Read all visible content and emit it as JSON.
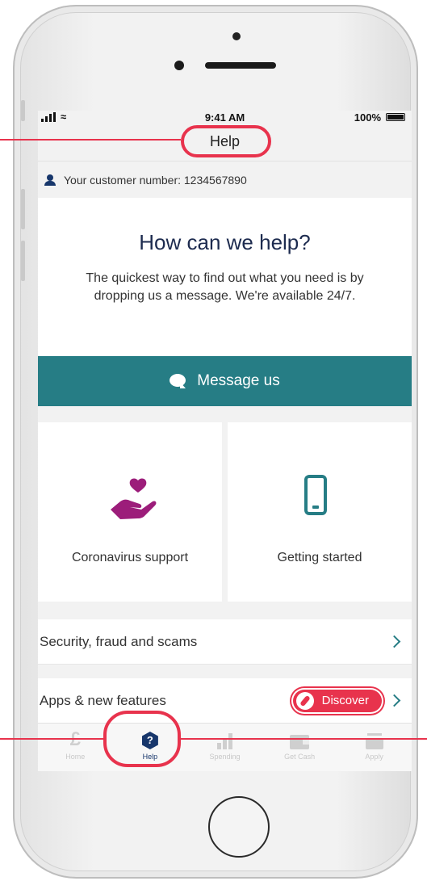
{
  "status_bar": {
    "time": "9:41 AM",
    "battery": "100%"
  },
  "header": {
    "title": "Help"
  },
  "customer": {
    "text": "Your customer number: 1234567890"
  },
  "help": {
    "heading": "How can we help?",
    "body": "The quickest way to find out what you need is by dropping us a message. We're available 24/7.",
    "message_button": "Message us"
  },
  "tiles": [
    {
      "label": "Coronavirus support",
      "icon": "heart-hand-icon",
      "color": "#9c1d7a"
    },
    {
      "label": "Getting started",
      "icon": "phone-icon",
      "color": "#267d85"
    }
  ],
  "list": [
    {
      "label": "Security, fraud and scams"
    },
    {
      "label": "Apps & new features",
      "badge": "Discover"
    }
  ],
  "tab_bar": [
    {
      "label": "Home",
      "icon": "pound-icon",
      "active": false
    },
    {
      "label": "Help",
      "icon": "help-icon",
      "active": true
    },
    {
      "label": "Spending",
      "icon": "bar-chart-icon",
      "active": false
    },
    {
      "label": "Get Cash",
      "icon": "wallet-icon",
      "active": false
    },
    {
      "label": "Apply",
      "icon": "box-icon",
      "active": false
    }
  ],
  "colors": {
    "accent": "#267d85",
    "brand_navy": "#17366b",
    "highlight": "#e8334d",
    "tile_icon": "#9c1d7a"
  }
}
